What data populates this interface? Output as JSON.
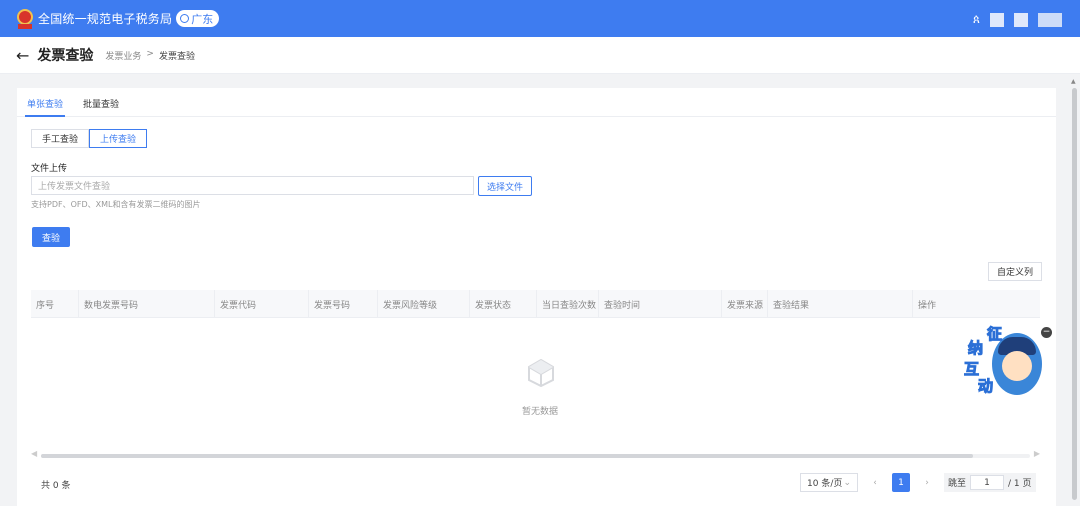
{
  "header": {
    "title": "全国统一规范电子税务局",
    "region": "广东",
    "user_icon": "user-icon"
  },
  "breadcrumb": {
    "back_icon": "←",
    "page_title": "发票查验",
    "items": [
      "发票业务",
      "发票查验"
    ],
    "separator": ">"
  },
  "tabs": [
    "单张查验",
    "批量查验"
  ],
  "mode_switch": [
    "手工查验",
    "上传查验"
  ],
  "upload": {
    "label": "文件上传",
    "placeholder": "上传发票文件查验",
    "choose_button": "选择文件",
    "hint": "支持PDF、OFD、XML和含有发票二维码的图片"
  },
  "check_button": "查验",
  "custom_columns_button": "自定义列",
  "table": {
    "columns": [
      "序号",
      "数电发票号码",
      "发票代码",
      "发票号码",
      "发票风险等级",
      "发票状态",
      "当日查验次数",
      "查验时间",
      "发票来源",
      "查验结果",
      "操作"
    ],
    "empty_text": "暂无数据"
  },
  "pagination": {
    "total": "共 0 条",
    "page_size": "10 条/页",
    "current_page": "1",
    "jump_label": "跳至",
    "jump_value": "1",
    "total_pages": "/ 1 页"
  },
  "mascot": {
    "chars": [
      "征",
      "纳",
      "互",
      "动"
    ],
    "close": "−"
  },
  "colors": {
    "primary": "#3e7cf0",
    "background": "#f2f3f5"
  }
}
